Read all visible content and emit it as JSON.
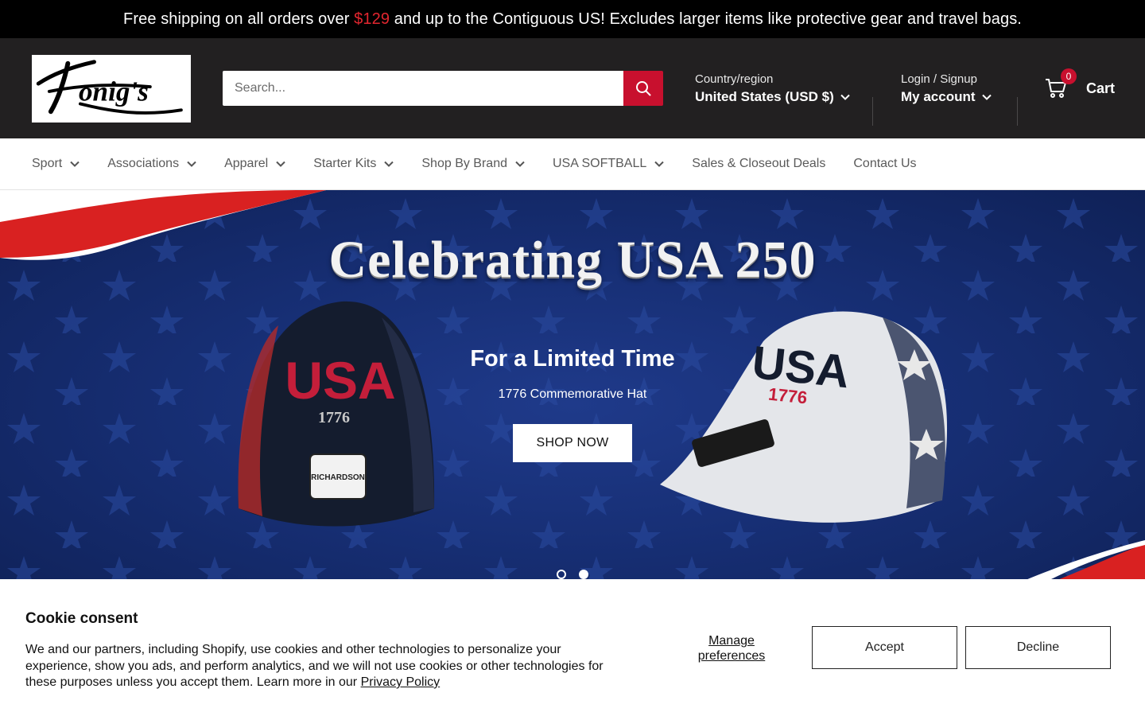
{
  "announcement": {
    "before": "Free shipping on all orders over ",
    "price": "$129",
    "after": " and up to the Contiguous US! Excludes larger items like protective gear and travel bags."
  },
  "header": {
    "logo_text": "Honig's",
    "search_placeholder": "Search...",
    "country_label": "Country/region",
    "country_value": "United States (USD $)",
    "login_label": "Login / Signup",
    "account_label": "My account",
    "cart_count": "0",
    "cart_label": "Cart"
  },
  "nav": {
    "items": [
      {
        "label": "Sport",
        "dropdown": true
      },
      {
        "label": "Associations",
        "dropdown": true
      },
      {
        "label": "Apparel",
        "dropdown": true
      },
      {
        "label": "Starter Kits",
        "dropdown": true
      },
      {
        "label": "Shop By Brand",
        "dropdown": true
      },
      {
        "label": "USA SOFTBALL",
        "dropdown": true
      },
      {
        "label": "Sales & Closeout Deals",
        "dropdown": false
      },
      {
        "label": "Contact Us",
        "dropdown": false
      }
    ]
  },
  "hero": {
    "title": "Celebrating USA 250",
    "subtitle": "For a Limited Time",
    "description": "1776 Commemorative Hat",
    "button": "SHOP NOW",
    "hat_left_text": "USA",
    "hat_left_year": "1776",
    "hat_left_tag": "RICHARDSON",
    "hat_right_text": "USA",
    "hat_right_year": "1776",
    "slides_total": 2,
    "slide_active": 2
  },
  "cookie": {
    "title": "Cookie consent",
    "text": "We and our partners, including Shopify, use cookies and other technologies to personalize your experience, show you ads, and perform analytics, and we will not use cookies or other technologies for these purposes unless you accept them. Learn more in our ",
    "privacy_link": "Privacy Policy",
    "manage": "Manage preferences",
    "accept": "Accept",
    "decline": "Decline"
  },
  "colors": {
    "header_bg": "#222021",
    "accent_red": "#c8102e",
    "hero_blue": "#172f75"
  }
}
